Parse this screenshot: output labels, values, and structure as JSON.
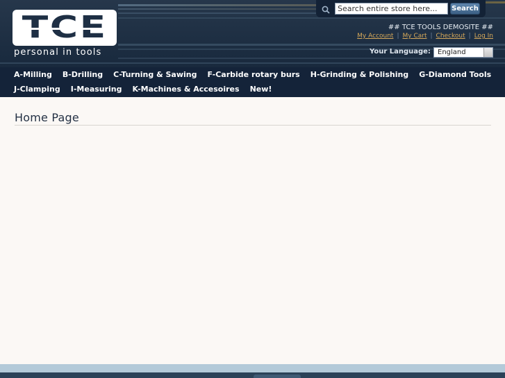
{
  "logo": {
    "letters": "TCE",
    "tagline": "personal in tools"
  },
  "search": {
    "placeholder": "Search entire store here...",
    "button_label": "Search"
  },
  "header": {
    "welcome": "## TCE TOOLS DEMOSITE ##",
    "links": [
      "My Account",
      "My Cart",
      "Checkout",
      "Log In"
    ],
    "language_label": "Your Language:",
    "language_selected": "England"
  },
  "nav": {
    "row1": [
      "A-Milling",
      "B-Drilling",
      "C-Turning & Sawing",
      "F-Carbide rotary burs",
      "H-Grinding & Polishing",
      "G-Diamond Tools"
    ],
    "row2": [
      "J-Clamping",
      "I-Measuring",
      "K-Machines & Accesoires",
      "New!"
    ]
  },
  "main": {
    "page_title": "Home Page"
  },
  "colors": {
    "header_bg": "#1b2c40",
    "link_accent": "#d7a95a",
    "content_bg": "#fbf8f5",
    "footer_bar": "#b3cad9"
  }
}
